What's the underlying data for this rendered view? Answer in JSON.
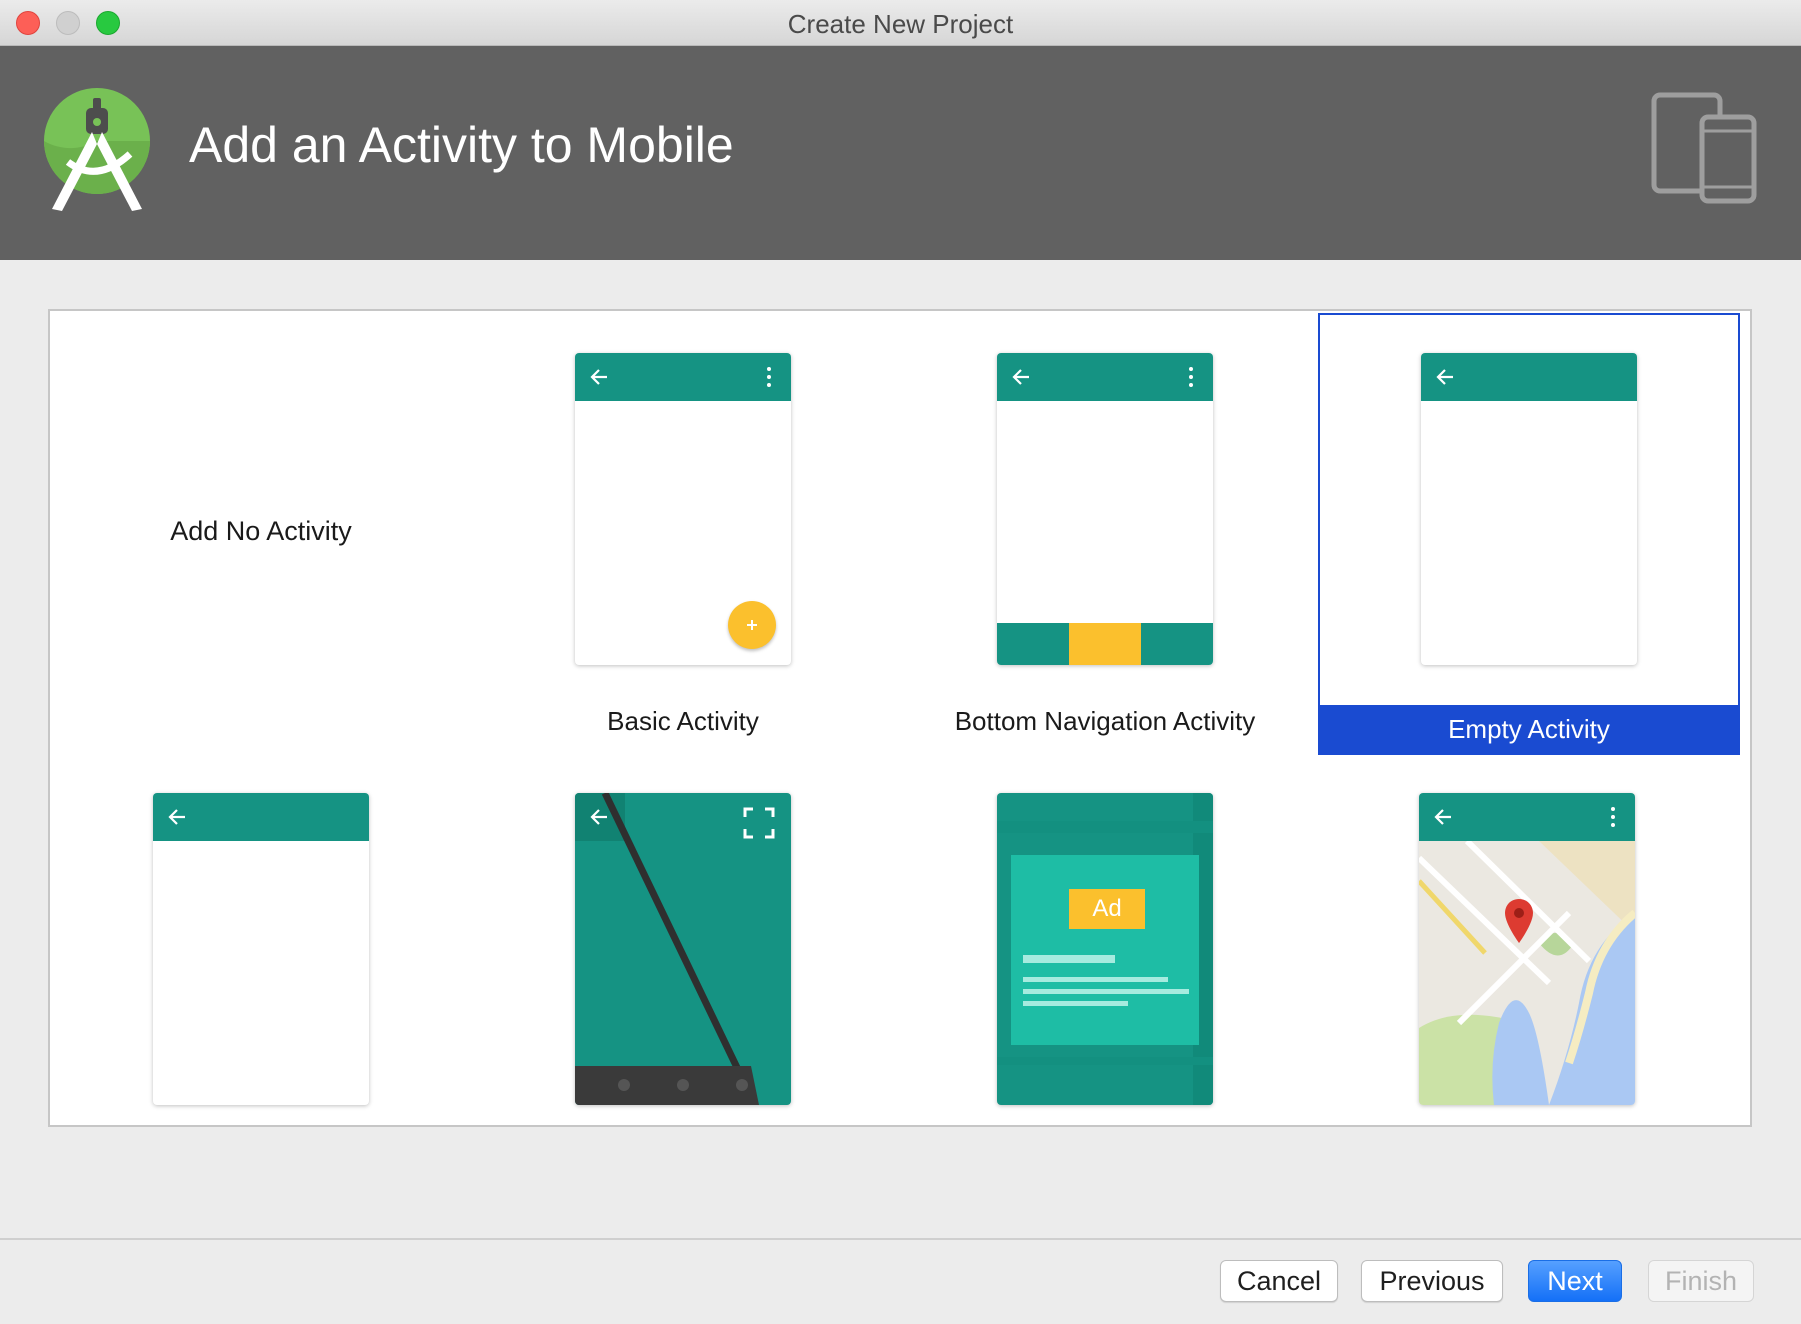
{
  "window": {
    "title": "Create New Project"
  },
  "header": {
    "title": "Add an Activity to Mobile",
    "logo_icon": "android-studio-logo-icon",
    "device_icon": "tablet-phone-icon",
    "background": "#616161"
  },
  "accent": {
    "teal": "#159383",
    "selection": "#1a4bd1",
    "fab": "#fbc02d"
  },
  "templates": {
    "no_activity": {
      "label": "Add No Activity"
    },
    "basic": {
      "label": "Basic Activity"
    },
    "bottom_nav": {
      "label": "Bottom Navigation Activity"
    },
    "empty": {
      "label": "Empty Activity",
      "selected": true
    },
    "fullscreen": {
      "label": ""
    },
    "admob": {
      "label": "",
      "ad_text": "Ad"
    },
    "maps": {
      "label": ""
    },
    "fragment": {
      "label": ""
    }
  },
  "buttons": {
    "cancel": "Cancel",
    "previous": "Previous",
    "next": "Next",
    "finish": "Finish"
  }
}
